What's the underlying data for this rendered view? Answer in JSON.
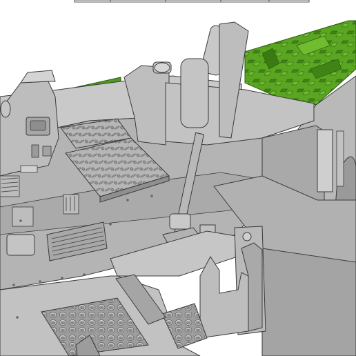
{
  "viewport": {
    "background": "#ffffff",
    "view_toolbar": {
      "visible": true,
      "state": "partially visible at top edge"
    }
  },
  "model": {
    "colors": {
      "body": "#b4b4b4",
      "body_light": "#c8c8c8",
      "body_dark": "#8f8f8f",
      "edge": "#3a3a3a",
      "green": "#4f9a1d",
      "green_light": "#66b22a",
      "green_dark": "#3b7a12"
    },
    "icons": [
      "toolbar-strip",
      "green-panel-icon",
      "checker-plate-icon",
      "vent-grille-icon",
      "rivet-icon",
      "circular-mesh-icon",
      "rod-handle-icon",
      "bracket-icon"
    ]
  }
}
